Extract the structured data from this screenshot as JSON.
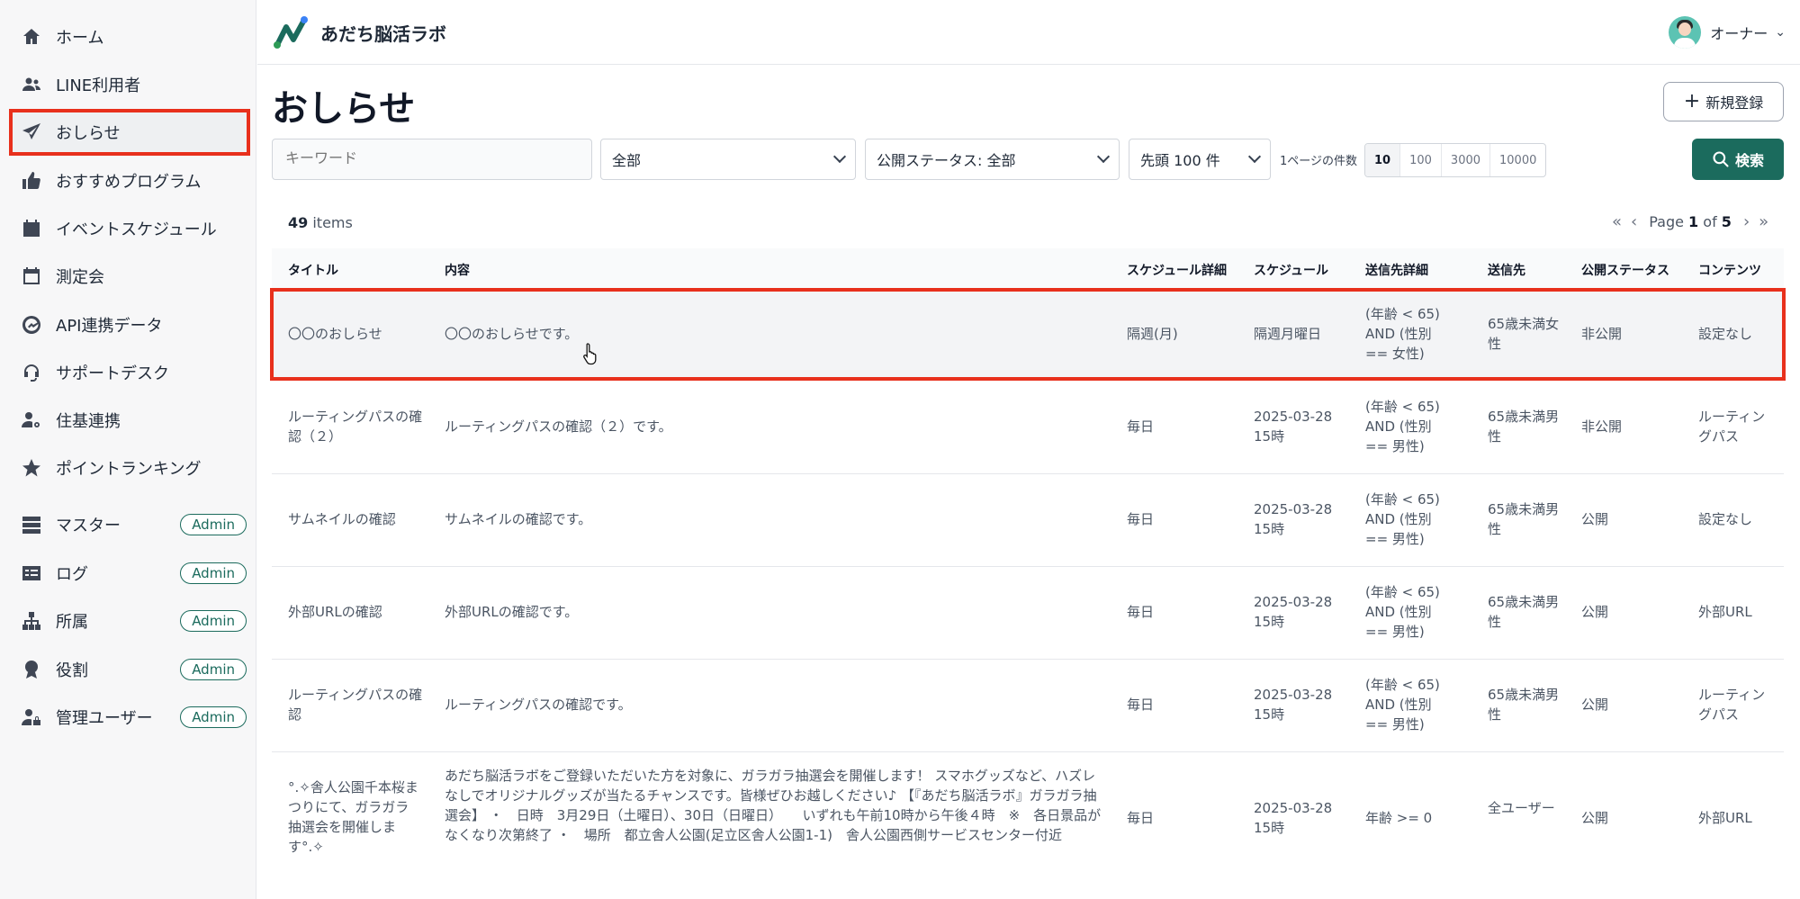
{
  "sidebar": {
    "items": [
      {
        "label": "ホーム"
      },
      {
        "label": "LINE利用者"
      },
      {
        "label": "おしらせ"
      },
      {
        "label": "おすすめプログラム"
      },
      {
        "label": "イベントスケジュール"
      },
      {
        "label": "測定会"
      },
      {
        "label": "API連携データ"
      },
      {
        "label": "サポートデスク"
      },
      {
        "label": "住基連携"
      },
      {
        "label": "ポイントランキング"
      },
      {
        "label": "マスター",
        "badge": "Admin"
      },
      {
        "label": "ログ",
        "badge": "Admin"
      },
      {
        "label": "所属",
        "badge": "Admin"
      },
      {
        "label": "役割",
        "badge": "Admin"
      },
      {
        "label": "管理ユーザー",
        "badge": "Admin"
      }
    ]
  },
  "header": {
    "brand": "あだち脳活ラボ",
    "user": "オーナー"
  },
  "page": {
    "title": "おしらせ",
    "new_button": "新規登録"
  },
  "filters": {
    "keyword_placeholder": "キーワード",
    "category": "全部",
    "status": "公開ステータス: 全部",
    "limit": "先頭 100 件",
    "per_page_label": "1ページの件数",
    "per_page_options": [
      "10",
      "100",
      "3000",
      "10000"
    ],
    "per_page_selected": "10",
    "search_button": "検索"
  },
  "table": {
    "count": "49",
    "count_suffix": "items",
    "page_prefix": "Page",
    "page": "1",
    "page_of": "of",
    "total_pages": "5",
    "columns": [
      "タイトル",
      "内容",
      "スケジュール詳細",
      "スケジュール",
      "送信先詳細",
      "送信先",
      "公開ステータス",
      "コンテンツ"
    ],
    "rows": [
      {
        "title": "〇〇のおしらせ",
        "content": "〇〇のおしらせです。",
        "schedule_detail": "隔週(月)",
        "schedule": "隔週月曜日",
        "target_detail": "(年齢 < 65) AND (性別 == 女性)",
        "target": "65歳未満女性",
        "status": "非公開",
        "contents": "設定なし"
      },
      {
        "title": "ルーティングパスの確認（２）",
        "content": "ルーティングパスの確認（２）です。",
        "schedule_detail": "毎日",
        "schedule": "2025-03-28 15時",
        "target_detail": "(年齢 < 65) AND (性別 == 男性)",
        "target": "65歳未満男性",
        "status": "非公開",
        "contents": "ルーティングパス"
      },
      {
        "title": "サムネイルの確認",
        "content": "サムネイルの確認です。",
        "schedule_detail": "毎日",
        "schedule": "2025-03-28 15時",
        "target_detail": "(年齢 < 65) AND (性別 == 男性)",
        "target": "65歳未満男性",
        "status": "公開",
        "contents": "設定なし"
      },
      {
        "title": "外部URLの確認",
        "content": "外部URLの確認です。",
        "schedule_detail": "毎日",
        "schedule": "2025-03-28 15時",
        "target_detail": "(年齢 < 65) AND (性別 == 男性)",
        "target": "65歳未満男性",
        "status": "公開",
        "contents": "外部URL"
      },
      {
        "title": "ルーティングパスの確認",
        "content": "ルーティングパスの確認です。",
        "schedule_detail": "毎日",
        "schedule": "2025-03-28 15時",
        "target_detail": "(年齢 < 65) AND (性別 == 男性)",
        "target": "65歳未満男性",
        "status": "公開",
        "contents": "ルーティングパス"
      },
      {
        "title": "°.✧舎人公園千本桜まつりにて、ガラガラ抽選会を開催します°.✧",
        "content": "あだち脳活ラボをご登録いただいた方を対象に、ガラガラ抽選会を開催します！ スマホグッズなど、ハズレなしでオリジナルグッズが当たるチャンスです。皆様ぜひお越しください♪ 【『あだち脳活ラボ』ガラガラ抽選会】 ・　日時　3月29日（土曜日）、30日（日曜日）　　いずれも午前10時から午後４時　※　各日景品がなくなり次第終了 ・　場所　都立舎人公園(足立区舎人公園1-1)　舎人公園西側サービスセンター付近",
        "schedule_detail": "毎日",
        "schedule": "2025-03-28 15時",
        "target_detail": "年齢 >= 0",
        "target": "全ユーザー",
        "status": "公開",
        "contents": "外部URL"
      }
    ]
  }
}
